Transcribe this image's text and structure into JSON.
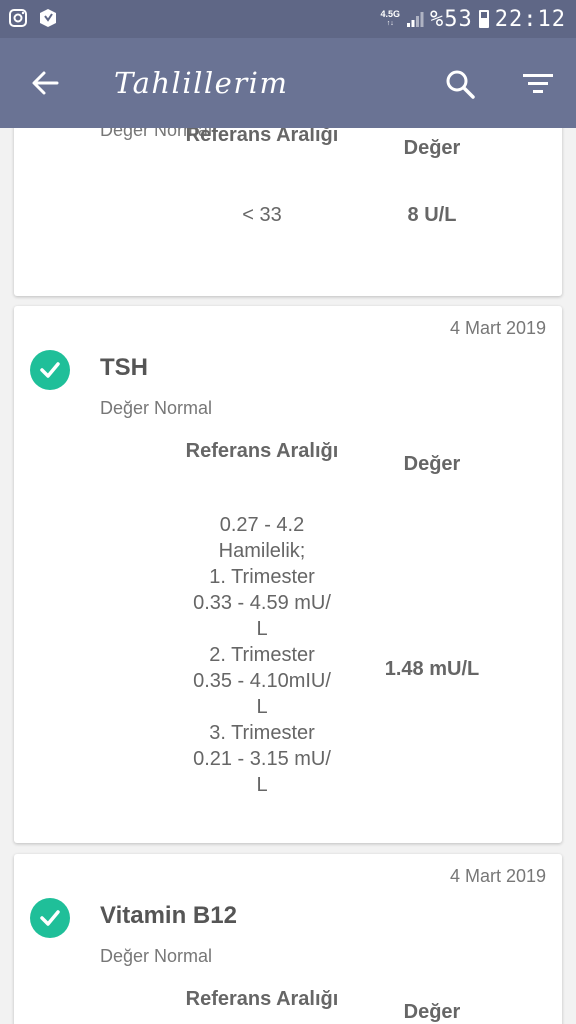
{
  "status_bar": {
    "network_type": "4.5G",
    "network_sub": "↑↓",
    "battery": "%53",
    "time": "22:12",
    "icons": [
      "instagram-icon",
      "app-notification-icon",
      "signal-icon",
      "battery-icon"
    ]
  },
  "app_bar": {
    "title": "Tahlillerim",
    "icons": [
      "back-arrow-icon",
      "search-icon",
      "filter-icon"
    ]
  },
  "colors": {
    "status_bar": "#5f6786",
    "app_bar": "#6a7394",
    "check": "#1fbf99",
    "background": "#f2f2f2"
  },
  "cards": [
    {
      "status": "Değer Normal",
      "ref_header": "Referans Aralığı",
      "value_header": "Değer",
      "ref_value": "< 33",
      "value": "8 U/L"
    },
    {
      "date": "4 Mart 2019",
      "title": "TSH",
      "status": "Değer Normal",
      "ref_header": "Referans Aralığı",
      "value_header": "Değer",
      "ref_value": "0.27 - 4.2\nHamilelik;\n1. Trimester\n0.33 - 4.59 mU/\nL\n2. Trimester\n0.35 - 4.10mIU/\nL\n3. Trimester\n0.21 - 3.15 mU/\nL",
      "value": "1.48 mU/L"
    },
    {
      "date": "4 Mart 2019",
      "title": "Vitamin B12",
      "status": "Değer Normal",
      "ref_header": "Referans Aralığı",
      "value_header": "Değer"
    }
  ]
}
